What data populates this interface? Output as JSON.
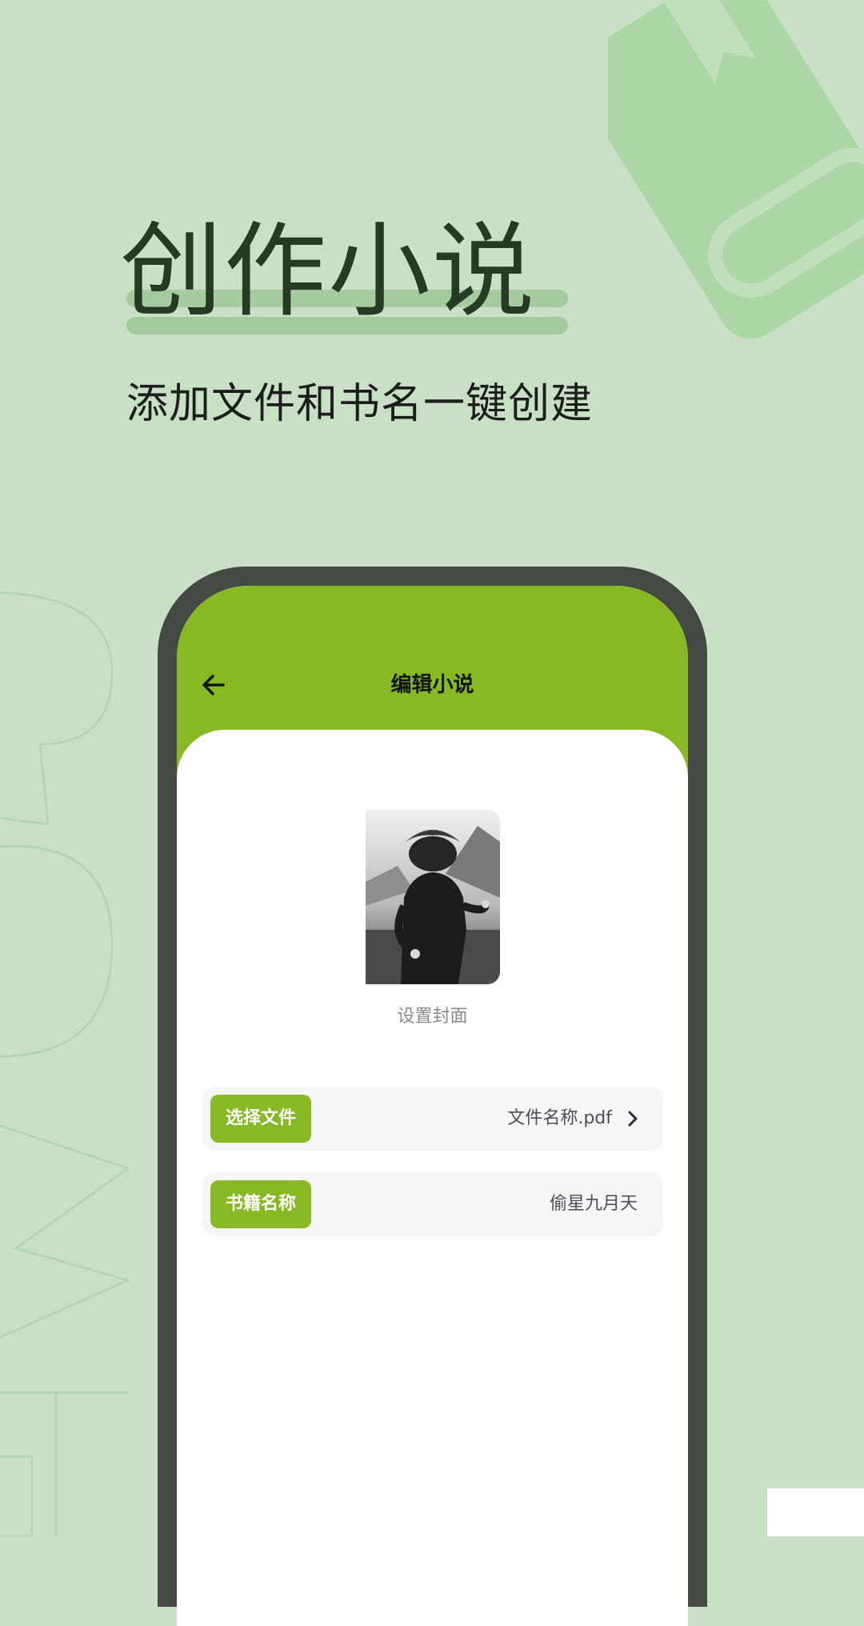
{
  "hero": {
    "title": "创作小说",
    "subtitle": "添加文件和书名一键创建"
  },
  "phone": {
    "header": {
      "title": "编辑小说",
      "back_icon": "arrow-left-icon"
    },
    "cover": {
      "caption": "设置封面"
    },
    "form": {
      "file": {
        "label": "选择文件",
        "value": "文件名称.pdf",
        "icon": "chevron-right-icon"
      },
      "book_name": {
        "label": "书籍名称",
        "value": "偷星九月天"
      }
    }
  },
  "colors": {
    "background": "#c9e0c6",
    "accent": "#88b824",
    "phone_frame": "#434b42",
    "title_text": "#263b24"
  }
}
